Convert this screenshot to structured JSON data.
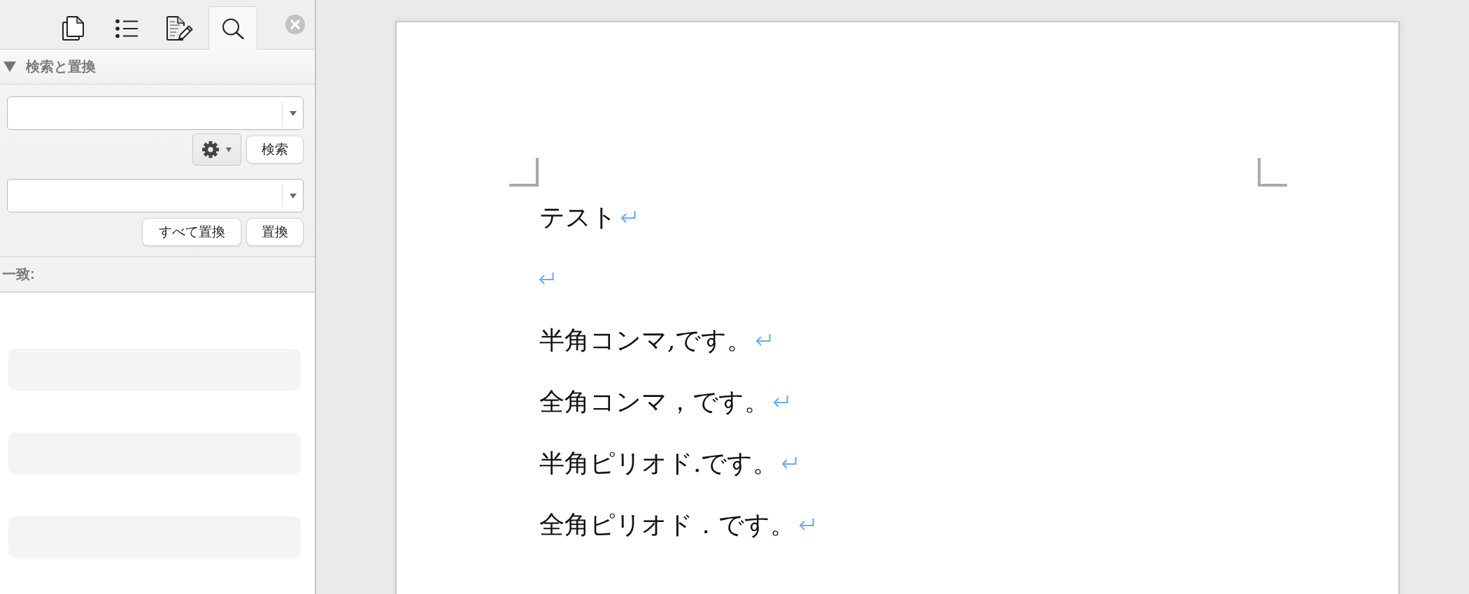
{
  "sidebar": {
    "tabs": [
      {
        "kind": "pages",
        "selected": false
      },
      {
        "kind": "outline",
        "selected": false
      },
      {
        "kind": "notes",
        "selected": false
      },
      {
        "kind": "search",
        "selected": true
      }
    ],
    "find_replace": {
      "title": "検索と置換",
      "expanded": true,
      "find_button": "検索",
      "replace_all_button": "すべて置換",
      "replace_button": "置換"
    },
    "matches": {
      "title": "一致:",
      "results": [
        {
          "kind": "empty"
        },
        {
          "kind": "empty"
        },
        {
          "kind": "empty"
        }
      ]
    }
  },
  "document": {
    "show_formatting_marks": true,
    "paragraphs": [
      {
        "kind": "text",
        "text": "テスト"
      },
      {
        "kind": "blank"
      },
      {
        "kind": "text",
        "text": "半角コンマ,です。"
      },
      {
        "kind": "text",
        "text": "全角コンマ，です。"
      },
      {
        "kind": "text",
        "text": "半角ピリオド.です。"
      },
      {
        "kind": "text",
        "text": "全角ピリオド．です。"
      }
    ]
  }
}
